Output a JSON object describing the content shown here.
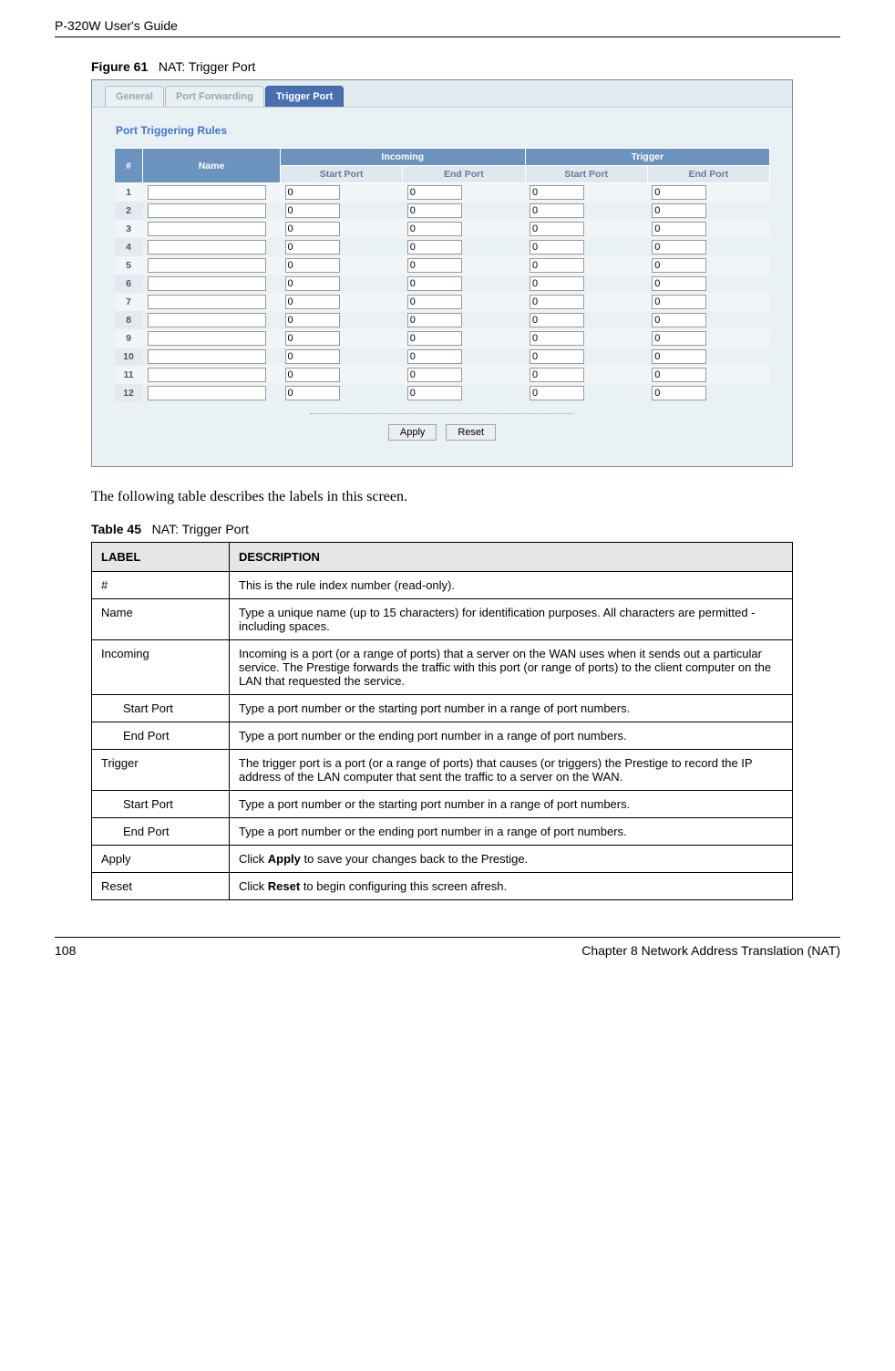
{
  "header": {
    "guide_title": "P-320W User's Guide"
  },
  "figure": {
    "label": "Figure 61",
    "title": "NAT: Trigger Port"
  },
  "screenshot": {
    "tabs": {
      "general": "General",
      "port_forwarding": "Port Forwarding",
      "trigger_port": "Trigger Port"
    },
    "section_title": "Port Triggering Rules",
    "headers": {
      "num": "#",
      "name": "Name",
      "incoming": "Incoming",
      "trigger": "Trigger",
      "start_port": "Start Port",
      "end_port": "End Port"
    },
    "rows": [
      {
        "n": "1",
        "name": "",
        "isp": "0",
        "iep": "0",
        "tsp": "0",
        "tep": "0"
      },
      {
        "n": "2",
        "name": "",
        "isp": "0",
        "iep": "0",
        "tsp": "0",
        "tep": "0"
      },
      {
        "n": "3",
        "name": "",
        "isp": "0",
        "iep": "0",
        "tsp": "0",
        "tep": "0"
      },
      {
        "n": "4",
        "name": "",
        "isp": "0",
        "iep": "0",
        "tsp": "0",
        "tep": "0"
      },
      {
        "n": "5",
        "name": "",
        "isp": "0",
        "iep": "0",
        "tsp": "0",
        "tep": "0"
      },
      {
        "n": "6",
        "name": "",
        "isp": "0",
        "iep": "0",
        "tsp": "0",
        "tep": "0"
      },
      {
        "n": "7",
        "name": "",
        "isp": "0",
        "iep": "0",
        "tsp": "0",
        "tep": "0"
      },
      {
        "n": "8",
        "name": "",
        "isp": "0",
        "iep": "0",
        "tsp": "0",
        "tep": "0"
      },
      {
        "n": "9",
        "name": "",
        "isp": "0",
        "iep": "0",
        "tsp": "0",
        "tep": "0"
      },
      {
        "n": "10",
        "name": "",
        "isp": "0",
        "iep": "0",
        "tsp": "0",
        "tep": "0"
      },
      {
        "n": "11",
        "name": "",
        "isp": "0",
        "iep": "0",
        "tsp": "0",
        "tep": "0"
      },
      {
        "n": "12",
        "name": "",
        "isp": "0",
        "iep": "0",
        "tsp": "0",
        "tep": "0"
      }
    ],
    "buttons": {
      "apply": "Apply",
      "reset": "Reset"
    }
  },
  "body_text": "The following table describes the labels in this screen.",
  "table": {
    "label": "Table 45",
    "title": "NAT: Trigger Port",
    "head_label": "LABEL",
    "head_desc": "DESCRIPTION",
    "rows": [
      {
        "label": "#",
        "desc": "This is the rule index number (read-only).",
        "indent": false
      },
      {
        "label": "Name",
        "desc": "Type a unique name (up to 15 characters) for identification purposes. All characters are permitted - including spaces.",
        "indent": false
      },
      {
        "label": "Incoming",
        "desc": "Incoming is a port (or a range of ports) that a server on the WAN uses when it sends out a particular service. The Prestige forwards the traffic with this port (or range of ports) to the client computer on the LAN that requested the service.",
        "indent": false
      },
      {
        "label": "Start Port",
        "desc": "Type a port number or the starting port number in a range of port numbers.",
        "indent": true
      },
      {
        "label": "End Port",
        "desc": "Type a port number or the ending port number in a range of port numbers.",
        "indent": true
      },
      {
        "label": "Trigger",
        "desc": "The trigger port is a port (or a range of ports) that causes (or triggers) the Prestige to record the IP address of the LAN computer that sent the traffic to a server on the WAN.",
        "indent": false
      },
      {
        "label": "Start Port",
        "desc": "Type a port number or the starting port number in a range of port numbers.",
        "indent": true
      },
      {
        "label": "End Port",
        "desc": "Type a port number or the ending port number in a range of port numbers.",
        "indent": true
      },
      {
        "label": "Apply",
        "desc_html": "Click <b>Apply</b> to save your changes back to the Prestige.",
        "indent": false
      },
      {
        "label": "Reset",
        "desc_html": "Click <b>Reset</b> to begin configuring this screen afresh.",
        "indent": false
      }
    ]
  },
  "footer": {
    "page": "108",
    "chapter": "Chapter 8 Network Address Translation (NAT)"
  }
}
